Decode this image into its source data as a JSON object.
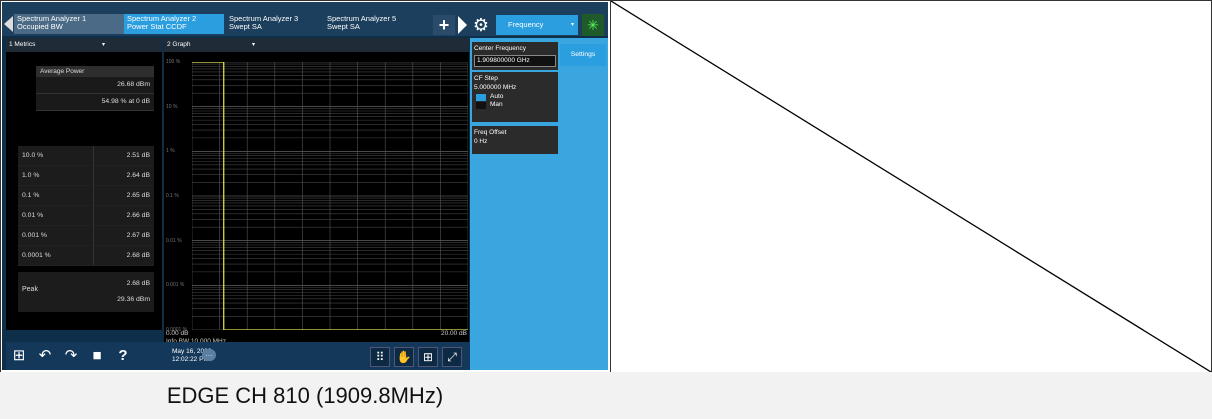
{
  "tabs": [
    {
      "line1": "Spectrum Analyzer 1",
      "line2": "Occupied BW"
    },
    {
      "line1": "Spectrum Analyzer 2",
      "line2": "Power Stat CCDF"
    },
    {
      "line1": "Spectrum Analyzer 3",
      "line2": "Swept SA"
    },
    {
      "line1": "Spectrum Analyzer 5",
      "line2": "Swept SA"
    }
  ],
  "toolbar": {
    "plus": "+",
    "gear": "⚙",
    "frequency_label": "Frequency",
    "dropdown": "▾",
    "status_icon": "✳"
  },
  "metrics_pane": {
    "header": "1 Metrics",
    "dropdown": "▾",
    "avg_power_label": "Average Power",
    "avg_power_value": "26.68 dBm",
    "avg_power_pct": "54.98 % at 0 dB",
    "ccdf_rows": [
      {
        "pct": "10.0 %",
        "db": "2.51 dB"
      },
      {
        "pct": "1.0 %",
        "db": "2.64 dB"
      },
      {
        "pct": "0.1 %",
        "db": "2.65 dB"
      },
      {
        "pct": "0.01 %",
        "db": "2.66 dB"
      },
      {
        "pct": "0.001 %",
        "db": "2.67 dB"
      },
      {
        "pct": "0.0001 %",
        "db": "2.68 dB"
      }
    ],
    "peak_label": "Peak",
    "peak_db": "2.68 dB",
    "peak_dbm": "29.36 dBm"
  },
  "graph_pane": {
    "header": "2 Graph",
    "dropdown": "▾",
    "y_ticks": [
      "100 %",
      "10 %",
      "1 %",
      "0.1 %",
      "0.01 %",
      "0.001 %",
      "0.0001 %"
    ],
    "x_start": "0.00 dB",
    "x_end": "20.00 dB",
    "info_bw": "Info BW 10.000 MHz"
  },
  "chart_data": {
    "type": "line",
    "title": "",
    "xlabel": "",
    "ylabel": "",
    "xlim": [
      0,
      20
    ],
    "y_scale": "log",
    "ylim_pct": [
      0.0001,
      100
    ],
    "series": [
      {
        "x": [
          0.0,
          2.3,
          2.3,
          2.3,
          20.0
        ],
        "y": [
          100,
          100,
          54.98,
          0.0001,
          0.0001
        ]
      }
    ],
    "grid": true
  },
  "settings_panel": {
    "settings_tab": "Settings",
    "center_freq_label": "Center Frequency",
    "center_freq_value": "1.909800000 GHz",
    "cf_step_label": "CF Step",
    "cf_step_value": "5.000000 MHz",
    "auto_label": "Auto",
    "man_label": "Man",
    "freq_offset_label": "Freq Offset",
    "freq_offset_value": "0 Hz"
  },
  "bottom_bar": {
    "windows_icon": "⊞",
    "undo_icon": "↶",
    "redo_icon": "↷",
    "folder_icon": "■",
    "help_icon": "?",
    "date": "May 16, 2022",
    "time": "12:02:22 PM",
    "chat_icon": "…"
  },
  "caption": "EDGE CH 810 (1909.8MHz)",
  "colors": {
    "trace": "#e8e850",
    "accent": "#2b9ee0",
    "panel": "#39a6e0"
  }
}
